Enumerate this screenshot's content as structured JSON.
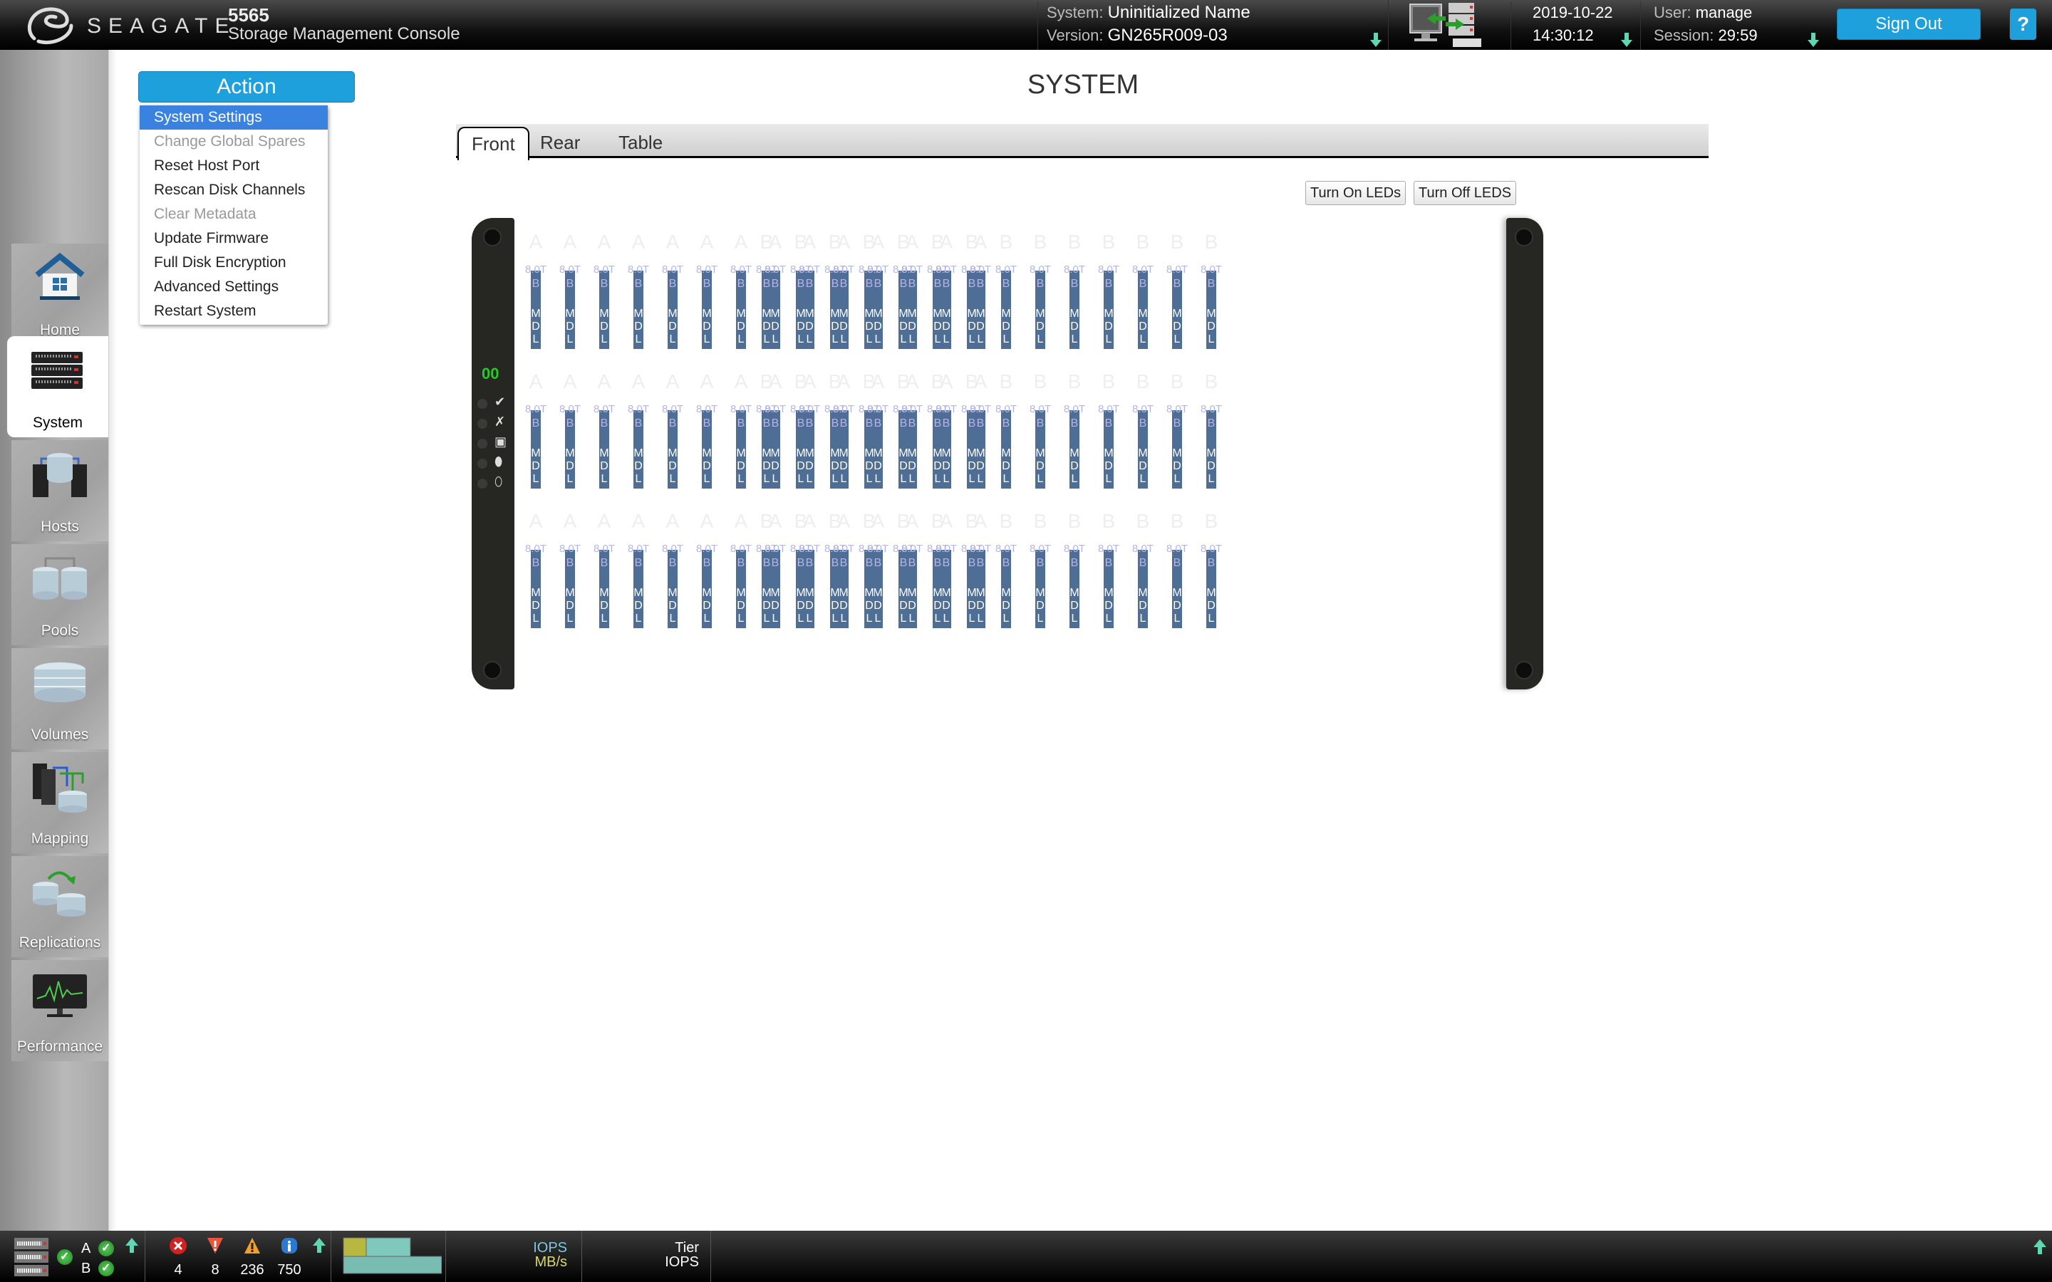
{
  "header": {
    "brand": "SEAGATE",
    "model": "5565",
    "subtitle": "Storage Management Console",
    "system_label": "System:",
    "system_name": "Uninitialized Name",
    "version_label": "Version:",
    "version": "GN265R009-03",
    "date": "2019-10-22",
    "time": "14:30:12",
    "user_label": "User:",
    "user": "manage",
    "session_label": "Session:",
    "session": "29:59",
    "sign_out": "Sign Out",
    "help": "?"
  },
  "nav": {
    "items": [
      {
        "label": "Home",
        "icon": "home-icon"
      },
      {
        "label": "System",
        "icon": "system-rack-icon",
        "active": true
      },
      {
        "label": "Hosts",
        "icon": "hosts-icon"
      },
      {
        "label": "Pools",
        "icon": "pools-icon"
      },
      {
        "label": "Volumes",
        "icon": "volumes-icon"
      },
      {
        "label": "Mapping",
        "icon": "mapping-icon"
      },
      {
        "label": "Replications",
        "icon": "replications-icon"
      },
      {
        "label": "Performance",
        "icon": "performance-icon"
      }
    ]
  },
  "action": {
    "button": "Action",
    "items": [
      {
        "label": "System Settings",
        "state": "selected"
      },
      {
        "label": "Change Global Spares",
        "state": "disabled"
      },
      {
        "label": "Reset Host Port",
        "state": "enabled"
      },
      {
        "label": "Rescan Disk Channels",
        "state": "enabled"
      },
      {
        "label": "Clear Metadata",
        "state": "disabled"
      },
      {
        "label": "Update Firmware",
        "state": "enabled"
      },
      {
        "label": "Full Disk Encryption",
        "state": "enabled"
      },
      {
        "label": "Advanced Settings",
        "state": "enabled"
      },
      {
        "label": "Restart System",
        "state": "enabled"
      }
    ]
  },
  "main": {
    "title": "SYSTEM",
    "tabs": [
      {
        "label": "Front",
        "active": true
      },
      {
        "label": "Rear"
      },
      {
        "label": "Table"
      }
    ],
    "turn_on_leds": "Turn On LEDs",
    "turn_off_leds": "Turn Off LEDS"
  },
  "enclosure": {
    "id": "00",
    "status_icons": [
      "check-icon",
      "fault-x-icon",
      "lock-icon",
      "disk-icon",
      "disk-alt-icon"
    ],
    "status_symbols": [
      "✔",
      "✗",
      "▣",
      "⬮",
      "⬯"
    ],
    "rows": 3,
    "groups": [
      {
        "controller": "A",
        "count": 14
      },
      {
        "controller": "B",
        "count": 14
      }
    ],
    "drive": {
      "capacity": "8.0T",
      "tier": "B",
      "type_letters": [
        "M",
        "D",
        "L"
      ]
    }
  },
  "footer": {
    "controllers": [
      {
        "name": "A",
        "status": "ok"
      },
      {
        "name": "B",
        "status": "ok"
      }
    ],
    "alerts": [
      {
        "type": "critical",
        "icon": "critical-x-icon",
        "count": "4"
      },
      {
        "type": "error",
        "icon": "error-triangle-icon",
        "count": "8"
      },
      {
        "type": "warning",
        "icon": "warning-triangle-icon",
        "count": "236"
      },
      {
        "type": "info",
        "icon": "info-icon",
        "count": "750"
      }
    ],
    "perf_label_1": "IOPS",
    "perf_label_2": "MB/s",
    "tier_label_1": "Tier",
    "tier_label_2": "IOPS"
  },
  "colors": {
    "accent": "#1ea0dc",
    "menu_selected": "#3a82e0",
    "drive_bar": "#4e6e96",
    "drive_text": "#b4b4e8",
    "status_ok": "#22cc22",
    "notify_arrow": "#5fd6b4"
  }
}
